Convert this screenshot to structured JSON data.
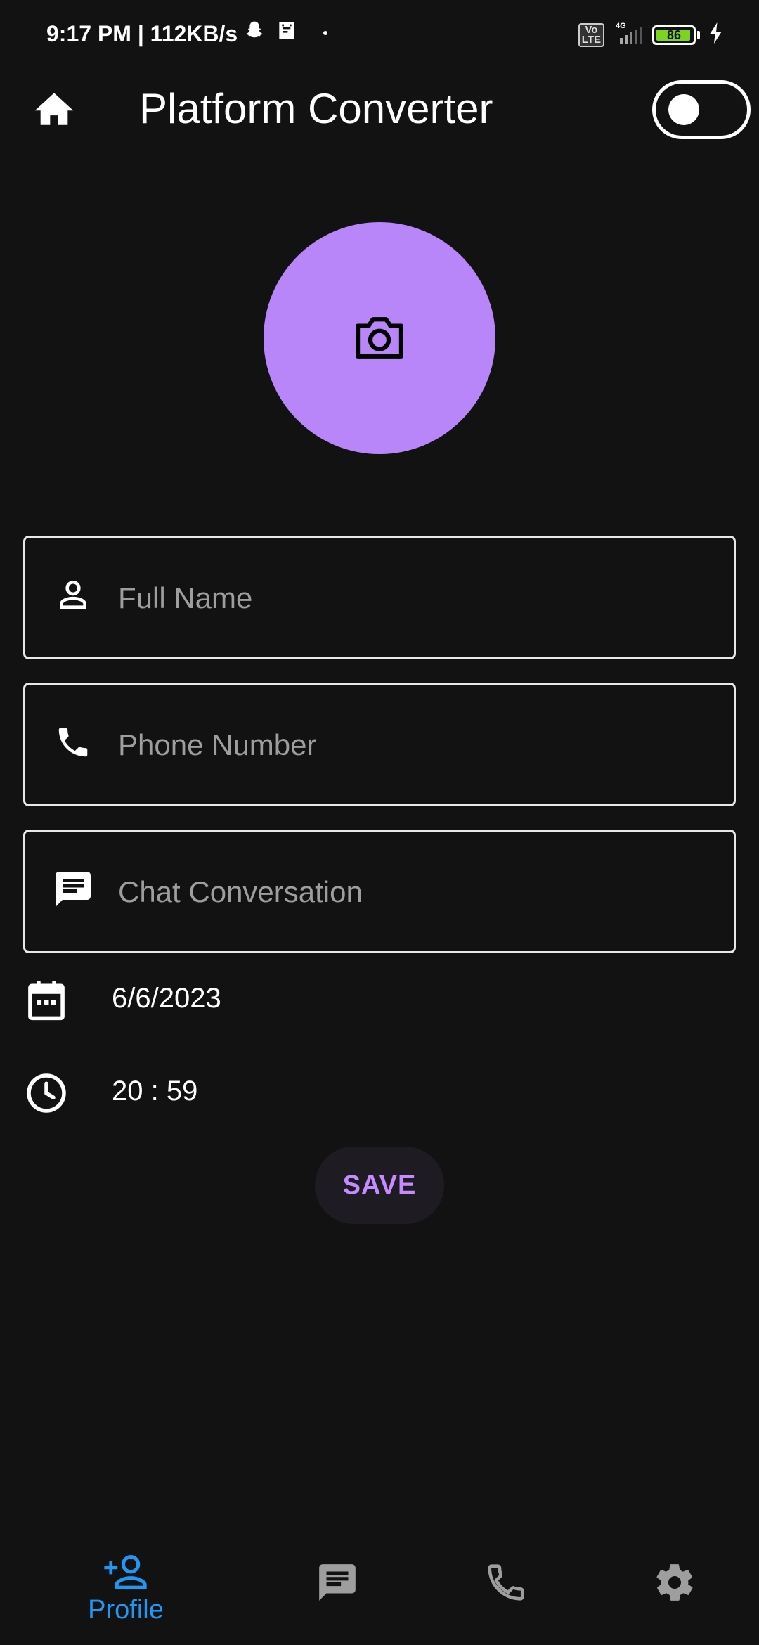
{
  "status_bar": {
    "time": "9:17 PM | 112KB/s",
    "network": "4G",
    "volte": "Vo\nLTE",
    "battery": "86"
  },
  "app_bar": {
    "title": "Platform Converter"
  },
  "form": {
    "full_name_placeholder": "Full Name",
    "phone_placeholder": "Phone Number",
    "chat_placeholder": "Chat Conversation",
    "date": "6/6/2023",
    "time": "20 : 59",
    "save_label": "SAVE"
  },
  "bottom_nav": {
    "items": [
      {
        "label": "Profile",
        "icon": "person-add-icon",
        "active": true
      },
      {
        "label": "",
        "icon": "chat-icon",
        "active": false
      },
      {
        "label": "",
        "icon": "phone-icon",
        "active": false
      },
      {
        "label": "",
        "icon": "settings-icon",
        "active": false
      }
    ]
  },
  "colors": {
    "background": "#121212",
    "avatar": "#b886f9",
    "accent": "#c68bff",
    "nav_active": "#2196f3",
    "nav_inactive": "#9e9e9e"
  }
}
